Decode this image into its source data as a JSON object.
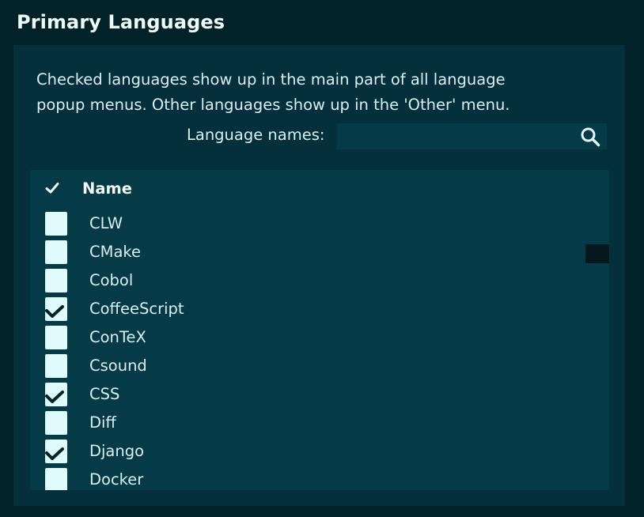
{
  "section": {
    "title": "Primary Languages"
  },
  "description": {
    "line1": "Checked languages show up in the main part of all language",
    "line2": "popup menus. Other languages show up in the 'Other' menu."
  },
  "search": {
    "label": "Language names:",
    "value": "",
    "icon": "search-icon"
  },
  "table": {
    "header_check_icon": "checkmark-icon",
    "header_name": "Name",
    "rows": [
      {
        "name": "CLW",
        "checked": false
      },
      {
        "name": "CMake",
        "checked": false
      },
      {
        "name": "Cobol",
        "checked": false
      },
      {
        "name": "CoffeeScript",
        "checked": true
      },
      {
        "name": "ConTeX",
        "checked": false
      },
      {
        "name": "Csound",
        "checked": false
      },
      {
        "name": "CSS",
        "checked": true
      },
      {
        "name": "Diff",
        "checked": false
      },
      {
        "name": "Django",
        "checked": true
      },
      {
        "name": "Docker",
        "checked": false
      }
    ]
  },
  "colors": {
    "background": "#02222a",
    "panel": "#03303b",
    "list": "#053a47",
    "checkbox": "#e0fbfe",
    "check_mark": "#02222a"
  }
}
